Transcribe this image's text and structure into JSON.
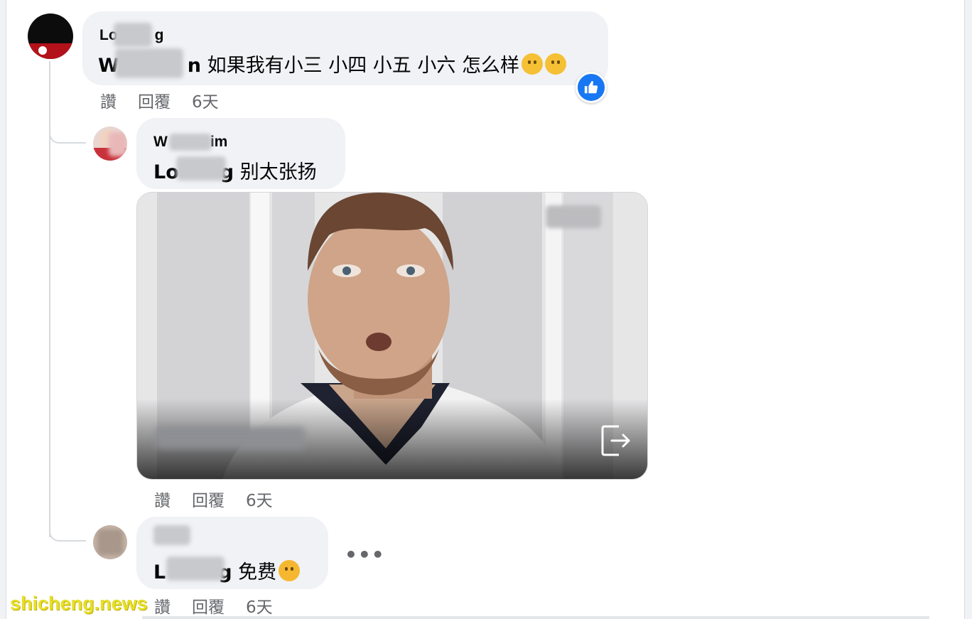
{
  "comments": [
    {
      "author": "Lo   g",
      "author_parts": [
        "Lo",
        "g"
      ],
      "text_prefix": "W",
      "text_suffix": "n",
      "text": "如果我有小三 小四 小五 小六 怎么样",
      "emojis": [
        "thinking-face-icon",
        "thinking-face-icon"
      ],
      "reaction": "like",
      "actions": {
        "like": "讚",
        "reply": "回覆",
        "time": "6天"
      }
    },
    {
      "author": "W   im",
      "author_parts": [
        "W",
        "im"
      ],
      "text_prefix": "Lo",
      "text_suffix": "g",
      "text": "别太张扬",
      "has_media": true,
      "actions": {
        "like": "讚",
        "reply": "回覆",
        "time": "6天"
      }
    },
    {
      "author": "",
      "text_prefix": "L",
      "text_suffix": "g",
      "text": "免费",
      "emojis": [
        "rolling-laughing-icon"
      ],
      "more": "•••",
      "actions": {
        "like": "讚",
        "reply": "回覆",
        "time": "6天"
      }
    }
  ],
  "watermark": "shicheng.news",
  "colors": {
    "bubble": "#f0f2f5",
    "meta_text": "#65676b",
    "like_blue": "#1877f2",
    "watermark_yellow": "#e6e02a"
  }
}
